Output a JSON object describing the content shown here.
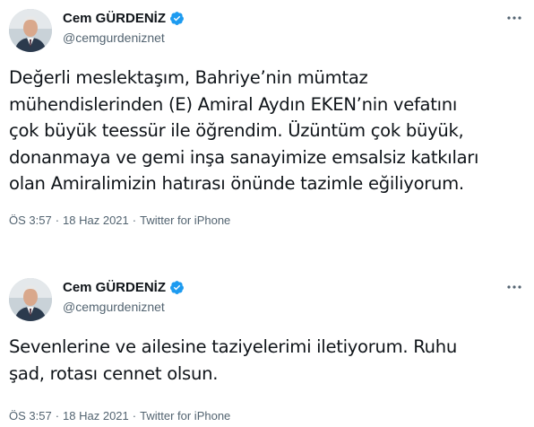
{
  "tweets": [
    {
      "author": {
        "name": "Cem GÜRDENİZ",
        "handle": "@cemgurdeniznet",
        "verified": true
      },
      "lines": [
        "Değerli meslektaşım, Bahriye’nin mümtaz",
        "mühendislerinden (E) Amiral Aydın EKEN’nin vefatını",
        "çok büyük teessür ile öğrendim. Üzüntüm çok büyük,",
        "donanmaya ve gemi inşa sanayimize emsalsiz katkıları",
        "olan Amiralimizin hatırası önünde tazimle eğiliyorum."
      ],
      "time": "ÖS 3:57",
      "date": "18 Haz 2021",
      "source": "Twitter for iPhone"
    },
    {
      "author": {
        "name": "Cem GÜRDENİZ",
        "handle": "@cemgurdeniznet",
        "verified": true
      },
      "lines": [
        "Sevenlerine ve ailesine taziyelerimi iletiyorum. Ruhu",
        "şad, rotası cennet olsun."
      ],
      "time": "ÖS 3:57",
      "date": "18 Haz 2021",
      "source": "Twitter for iPhone"
    }
  ],
  "separator": "·",
  "colors": {
    "verified_badge": "#1d9bf0",
    "secondary_text": "#536471",
    "primary_text": "#0f1419"
  }
}
